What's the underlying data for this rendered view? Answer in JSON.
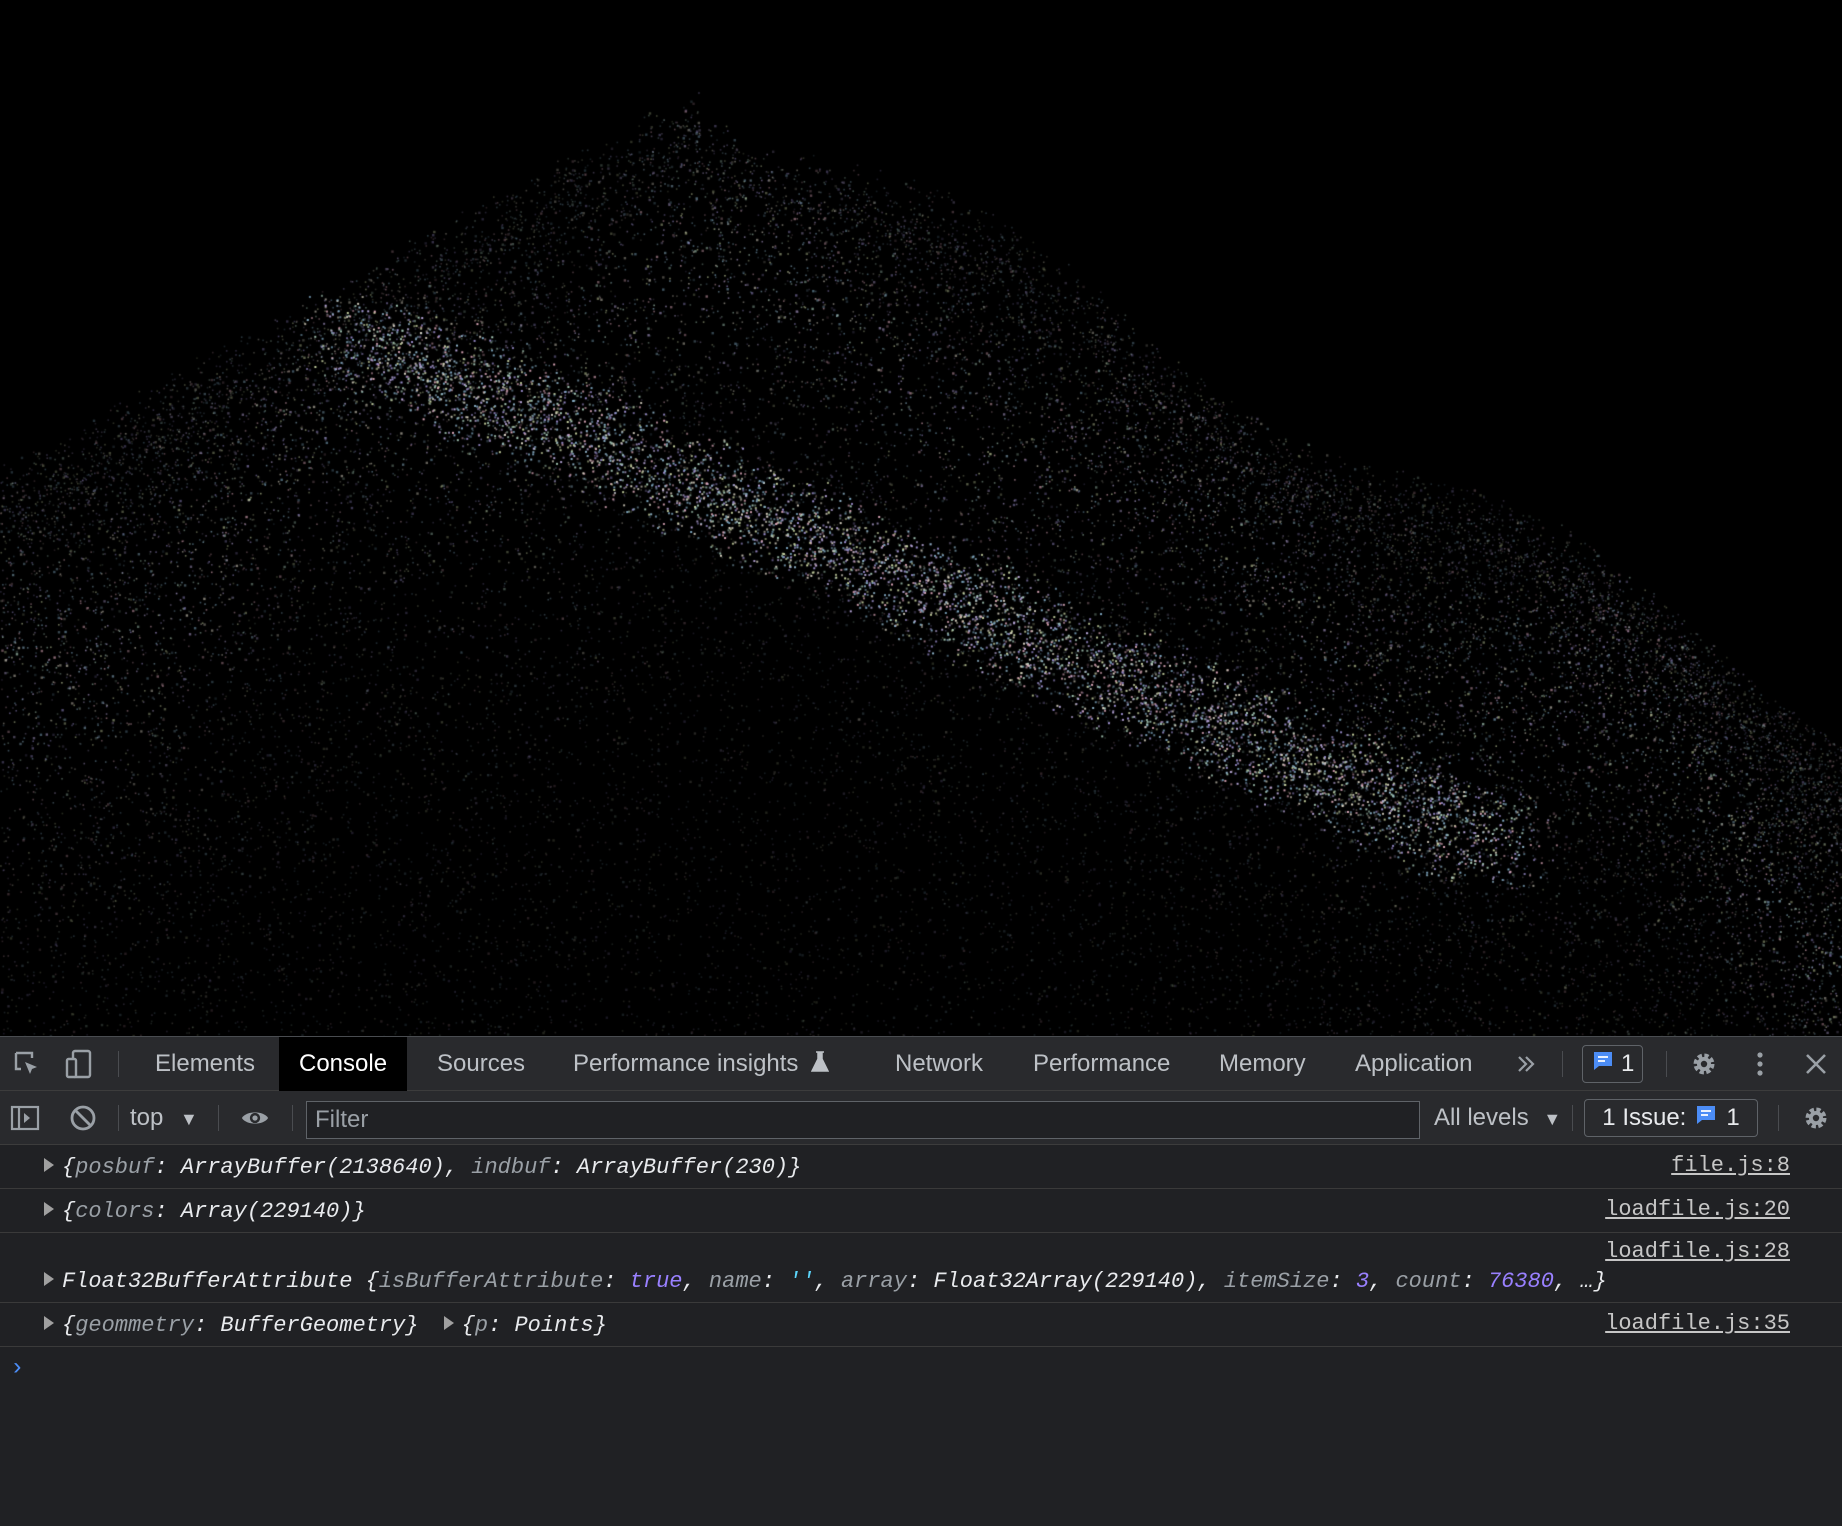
{
  "tabs": {
    "elements": "Elements",
    "console": "Console",
    "sources": "Sources",
    "performance_insights": "Performance insights",
    "network": "Network",
    "performance": "Performance",
    "memory": "Memory",
    "application": "Application"
  },
  "header": {
    "issues_count": "1"
  },
  "toolbar": {
    "context": "top",
    "filter_placeholder": "Filter",
    "levels": "All levels",
    "issues_label": "1 Issue:",
    "issues_count": "1"
  },
  "messages": [
    {
      "source": "file.js:8",
      "parts": [
        {
          "t": "{",
          "c": "p"
        },
        {
          "t": "posbuf",
          "c": "k"
        },
        {
          "t": ": ArrayBuffer(2138640), ",
          "c": "v"
        },
        {
          "t": "indbuf",
          "c": "k"
        },
        {
          "t": ": ArrayBuffer(230)}",
          "c": "v"
        }
      ]
    },
    {
      "source": "loadfile.js:20",
      "parts": [
        {
          "t": "{",
          "c": "p"
        },
        {
          "t": "colors",
          "c": "k"
        },
        {
          "t": ": Array(229140)}",
          "c": "v"
        }
      ]
    },
    {
      "source": "loadfile.js:28",
      "parts": [
        {
          "t": "Float32BufferAttribute {",
          "c": "v"
        },
        {
          "t": "isBufferAttribute",
          "c": "k"
        },
        {
          "t": ": ",
          "c": "v"
        },
        {
          "t": "true",
          "c": "kw"
        },
        {
          "t": ", ",
          "c": "v"
        },
        {
          "t": "name",
          "c": "k"
        },
        {
          "t": ": ",
          "c": "v"
        },
        {
          "t": "''",
          "c": "str"
        },
        {
          "t": ", ",
          "c": "v"
        },
        {
          "t": "array",
          "c": "k"
        },
        {
          "t": ": Float32Array(229140), ",
          "c": "v"
        },
        {
          "t": "itemSize",
          "c": "k"
        },
        {
          "t": ": ",
          "c": "v"
        },
        {
          "t": "3",
          "c": "num"
        },
        {
          "t": ", ",
          "c": "v"
        },
        {
          "t": "count",
          "c": "k"
        },
        {
          "t": ": ",
          "c": "v"
        },
        {
          "t": "76380",
          "c": "num"
        },
        {
          "t": ", …}",
          "c": "v"
        }
      ]
    },
    {
      "source": "loadfile.js:35",
      "parts": [
        {
          "t": "{",
          "c": "p"
        },
        {
          "t": "geommetry",
          "c": "k"
        },
        {
          "t": ": BufferGeometry}",
          "c": "v"
        }
      ],
      "parts2": [
        {
          "t": "{",
          "c": "p"
        },
        {
          "t": "p",
          "c": "k"
        },
        {
          "t": ": Points}",
          "c": "v"
        }
      ]
    }
  ],
  "colors": {
    "accent": "#4c8df6",
    "keyword": "#9980ff",
    "string": "#5cd5fb",
    "background": "#202124"
  }
}
